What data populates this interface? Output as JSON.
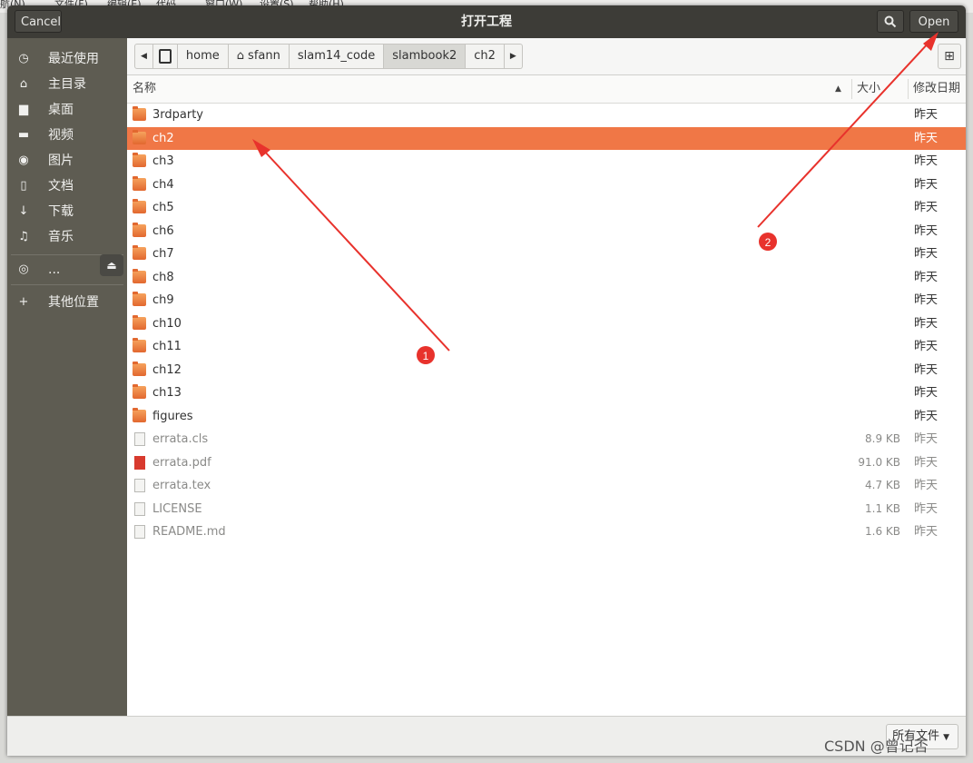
{
  "background_menu": [
    "航(N)",
    "文件(F)",
    "编辑(E)",
    "代码",
    "窗口(W)",
    "设置(S)",
    "帮助(H)"
  ],
  "dialog": {
    "title": "打开工程",
    "cancel_label": "Cancel",
    "open_label": "Open",
    "search_icon": "search-icon"
  },
  "sidebar": {
    "items": [
      {
        "icon": "recent-icon",
        "label": "最近使用"
      },
      {
        "icon": "home-icon",
        "label": "主目录"
      },
      {
        "icon": "desktop-icon",
        "label": "桌面"
      },
      {
        "icon": "video-icon",
        "label": "视频"
      },
      {
        "icon": "camera-icon",
        "label": "图片"
      },
      {
        "icon": "document-icon",
        "label": "文档"
      },
      {
        "icon": "download-icon",
        "label": "下载"
      },
      {
        "icon": "music-icon",
        "label": "音乐"
      }
    ],
    "device_label": "...",
    "other_locations": "其他位置"
  },
  "pathbar": [
    "home",
    "sfann",
    "slam14_code",
    "slambook2",
    "ch2"
  ],
  "columns": {
    "name": "名称",
    "size": "大小",
    "modified": "修改日期"
  },
  "files": [
    {
      "name": "3rdparty",
      "size": "",
      "modified": "昨天",
      "kind": "folder"
    },
    {
      "name": "ch2",
      "size": "",
      "modified": "昨天",
      "kind": "folder",
      "selected": true
    },
    {
      "name": "ch3",
      "size": "",
      "modified": "昨天",
      "kind": "folder"
    },
    {
      "name": "ch4",
      "size": "",
      "modified": "昨天",
      "kind": "folder"
    },
    {
      "name": "ch5",
      "size": "",
      "modified": "昨天",
      "kind": "folder"
    },
    {
      "name": "ch6",
      "size": "",
      "modified": "昨天",
      "kind": "folder"
    },
    {
      "name": "ch7",
      "size": "",
      "modified": "昨天",
      "kind": "folder"
    },
    {
      "name": "ch8",
      "size": "",
      "modified": "昨天",
      "kind": "folder"
    },
    {
      "name": "ch9",
      "size": "",
      "modified": "昨天",
      "kind": "folder"
    },
    {
      "name": "ch10",
      "size": "",
      "modified": "昨天",
      "kind": "folder"
    },
    {
      "name": "ch11",
      "size": "",
      "modified": "昨天",
      "kind": "folder"
    },
    {
      "name": "ch12",
      "size": "",
      "modified": "昨天",
      "kind": "folder"
    },
    {
      "name": "ch13",
      "size": "",
      "modified": "昨天",
      "kind": "folder"
    },
    {
      "name": "figures",
      "size": "",
      "modified": "昨天",
      "kind": "folder"
    },
    {
      "name": "errata.cls",
      "size": "8.9 KB",
      "modified": "昨天",
      "kind": "file"
    },
    {
      "name": "errata.pdf",
      "size": "91.0 KB",
      "modified": "昨天",
      "kind": "pdf"
    },
    {
      "name": "errata.tex",
      "size": "4.7 KB",
      "modified": "昨天",
      "kind": "file"
    },
    {
      "name": "LICENSE",
      "size": "1.1 KB",
      "modified": "昨天",
      "kind": "file"
    },
    {
      "name": "README.md",
      "size": "1.6 KB",
      "modified": "昨天",
      "kind": "file"
    }
  ],
  "filter_label": "所有文件",
  "annotations": {
    "marker1": "1",
    "marker2": "2",
    "color": "#e8322c"
  },
  "watermark": "CSDN @曾记否"
}
